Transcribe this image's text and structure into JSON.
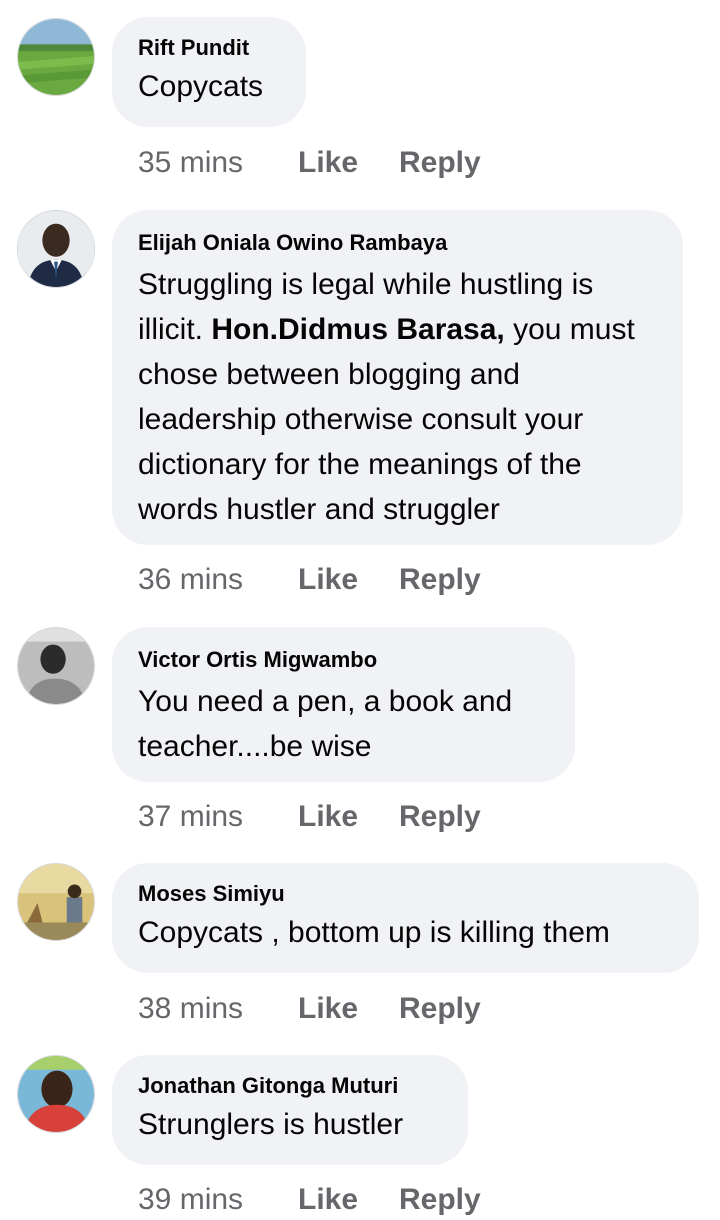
{
  "comments": [
    {
      "author": "Rift Pundit",
      "text": "Copycats",
      "time": "35 mins",
      "like_label": "Like",
      "reply_label": "Reply",
      "avatar_icon": "landscape-photo"
    },
    {
      "author": "Elijah Oniala Owino Rambaya",
      "text_before": "Struggling is legal while hustling is illicit. ",
      "mention": "Hon.Didmus Barasa,",
      "text_after": " you must chose between blogging and leadership otherwise consult your dictionary for the meanings of the words hustler and struggler",
      "time": "36 mins",
      "like_label": "Like",
      "reply_label": "Reply",
      "avatar_icon": "man-in-suit-photo"
    },
    {
      "author": "Victor Ortis Migwambo",
      "text": "You need a pen, a book and teacher....be wise",
      "time": "37 mins",
      "like_label": "Like",
      "reply_label": "Reply",
      "avatar_icon": "person-grayscale-photo"
    },
    {
      "author": "Moses Simiyu",
      "text": "Copycats , bottom up is killing them",
      "time": "38 mins",
      "like_label": "Like",
      "reply_label": "Reply",
      "avatar_icon": "person-outdoors-photo"
    },
    {
      "author": "Jonathan Gitonga Muturi",
      "text": "Strunglers is hustler",
      "time": "39 mins",
      "like_label": "Like",
      "reply_label": "Reply",
      "avatar_icon": "person-closeup-photo"
    }
  ]
}
